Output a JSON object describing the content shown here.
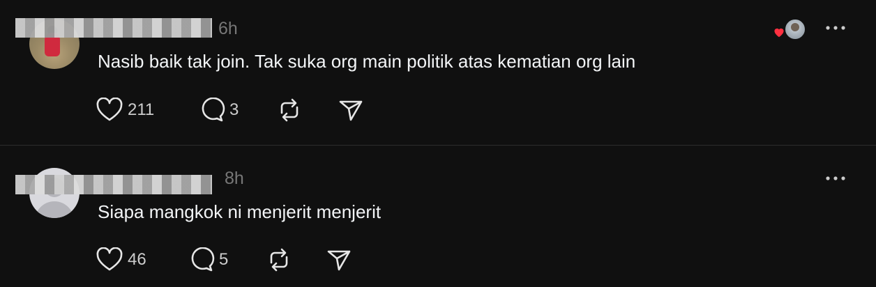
{
  "posts": [
    {
      "timestamp": "6h",
      "text": "Nasib baik tak join. Tak suka org main politik atas kematian org lain",
      "likes": "211",
      "replies": "3",
      "liked_by_author": true
    },
    {
      "timestamp": "8h",
      "text": "Siapa mangkok ni menjerit menjerit",
      "likes": "46",
      "replies": "5",
      "liked_by_author": false
    }
  ],
  "icons": {
    "like": "heart-icon",
    "reply": "comment-icon",
    "repost": "repost-icon",
    "share": "send-icon",
    "more": "ellipsis-icon"
  },
  "colors": {
    "background": "#101010",
    "text": "#f3f5f7",
    "muted": "#777777",
    "heart": "#ff3040",
    "divider": "#2d2d2d"
  }
}
